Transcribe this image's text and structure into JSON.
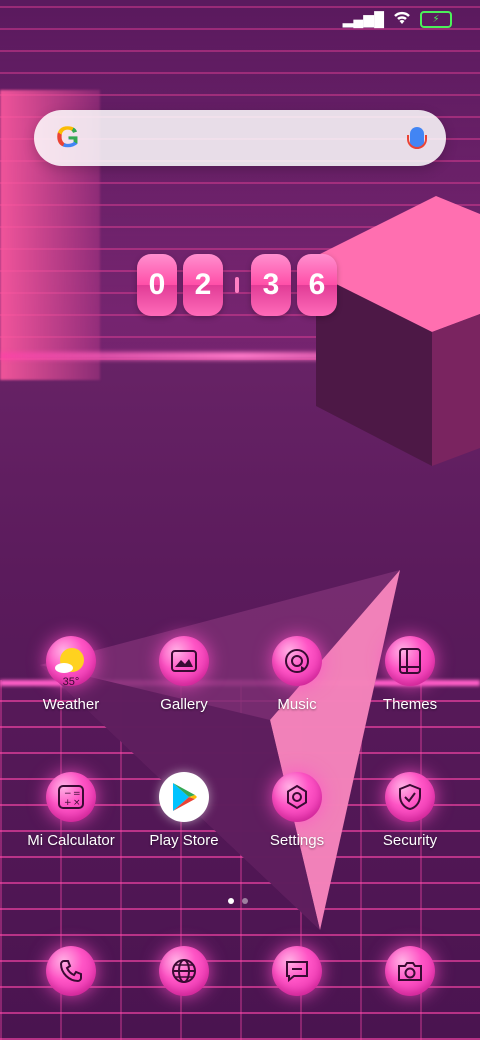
{
  "status": {
    "signal": "▂▄▆█",
    "wifi": "wifi",
    "battery": "⚡"
  },
  "search": {
    "google": "G"
  },
  "clock": {
    "h1": "0",
    "h2": "2",
    "m1": "3",
    "m2": "6"
  },
  "apps": [
    {
      "label": "Weather",
      "temp": "35°"
    },
    {
      "label": "Gallery"
    },
    {
      "label": "Music"
    },
    {
      "label": "Themes"
    },
    {
      "label": "Mi Calculator"
    },
    {
      "label": "Play Store"
    },
    {
      "label": "Settings"
    },
    {
      "label": "Security"
    }
  ],
  "dock": [
    "phone-icon",
    "browser-icon",
    "messages-icon",
    "camera-icon"
  ]
}
